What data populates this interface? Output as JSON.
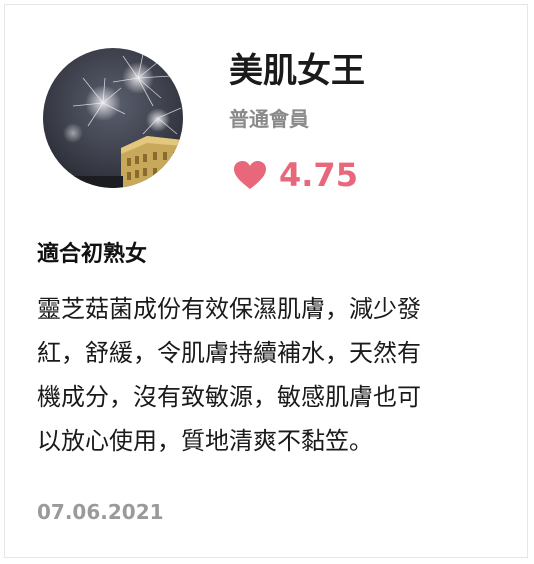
{
  "user": {
    "name": "美肌女王",
    "member_level": "普通會員",
    "rating": "4.75",
    "avatar_icon": "fireworks-photo"
  },
  "review": {
    "title": "適合初熟女",
    "body_lines": [
      "靈芝菇菌成份有效保濕肌膚，減少發",
      "紅，舒緩，令肌膚持續補水，天然有",
      "機成分，沒有致敏源，敏感肌膚也可",
      "以放心使用，質地清爽不黏笠。"
    ],
    "date": "07.06.2021"
  },
  "colors": {
    "accent": "#e8677a",
    "muted": "#8a8a8a",
    "text": "#1a1a1a"
  }
}
